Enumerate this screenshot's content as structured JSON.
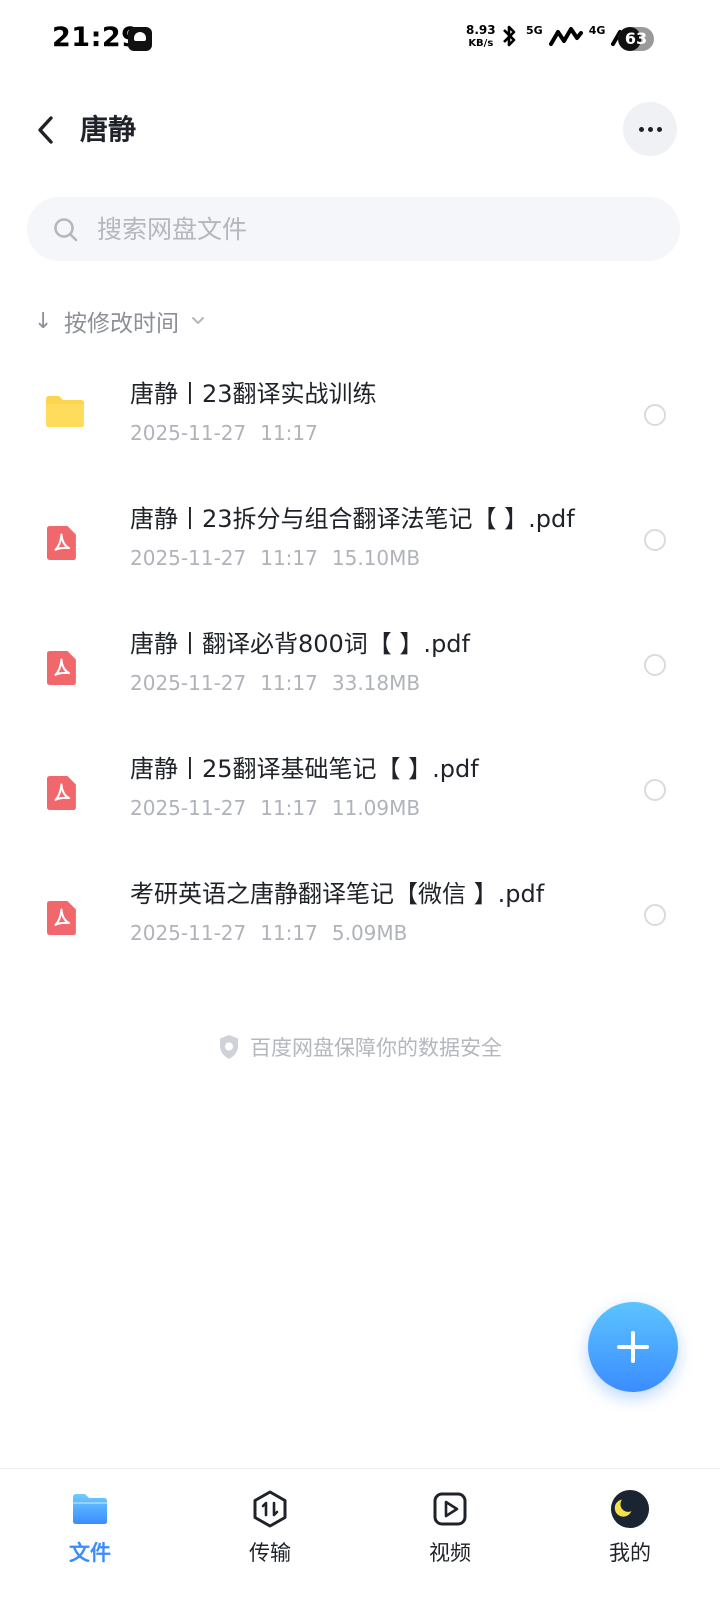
{
  "status_bar": {
    "time": "21:29",
    "net_speed_value": "8.93",
    "net_speed_unit": "KB/s",
    "signal_1_label": "5G",
    "signal_2_label": "4G",
    "battery_level": "63",
    "battery_fraction": 0.63
  },
  "header": {
    "title": "唐静",
    "back_icon": "chevron-left-icon",
    "more_icon": "more-horizontal-icon"
  },
  "search": {
    "placeholder": "搜索网盘文件",
    "value": ""
  },
  "sort": {
    "label": "按修改时间"
  },
  "files": [
    {
      "type": "folder",
      "icon": "folder-icon",
      "name": "唐静丨23翻译实战训练",
      "date": "2025-11-27",
      "time": "11:17",
      "size": ""
    },
    {
      "type": "pdf",
      "icon": "pdf-icon",
      "name": "唐静丨23拆分与组合翻译法笔记【 】.pdf",
      "date": "2025-11-27",
      "time": "11:17",
      "size": "15.10MB"
    },
    {
      "type": "pdf",
      "icon": "pdf-icon",
      "name": "唐静丨翻译必背800词【 】.pdf",
      "date": "2025-11-27",
      "time": "11:17",
      "size": "33.18MB"
    },
    {
      "type": "pdf",
      "icon": "pdf-icon",
      "name": "唐静丨25翻译基础笔记【 】.pdf",
      "date": "2025-11-27",
      "time": "11:17",
      "size": "11.09MB"
    },
    {
      "type": "pdf",
      "icon": "pdf-icon",
      "name": "考研英语之唐静翻译笔记【微信 】.pdf",
      "date": "2025-11-27",
      "time": "11:17",
      "size": "5.09MB"
    }
  ],
  "security_note": "百度网盘保障你的数据安全",
  "fab": {
    "icon": "plus-icon"
  },
  "bottom_nav": [
    {
      "label": "文件",
      "icon": "folder-nav-icon",
      "active": true
    },
    {
      "label": "传输",
      "icon": "transfer-icon",
      "active": false
    },
    {
      "label": "视频",
      "icon": "video-icon",
      "active": false
    },
    {
      "label": "我的",
      "icon": "avatar-icon",
      "active": false
    }
  ],
  "colors": {
    "accent": "#3b8cff",
    "folder": "#fcd54e",
    "pdf": "#f0686c",
    "text_primary": "#1f2329",
    "text_secondary": "#b0b3ba"
  }
}
